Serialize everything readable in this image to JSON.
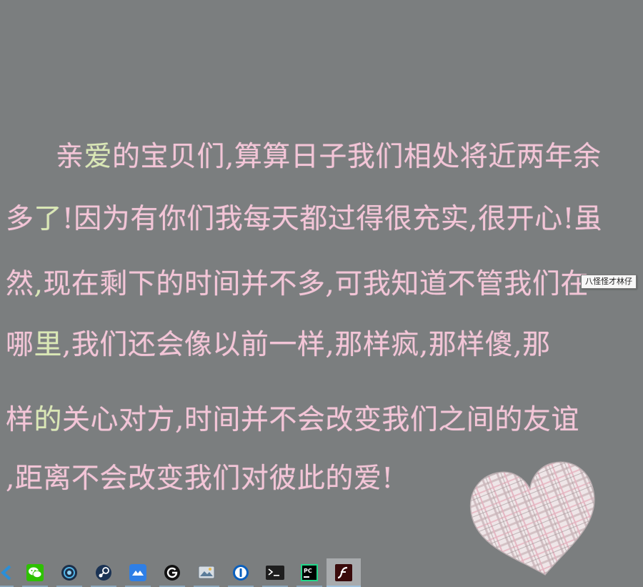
{
  "poem": {
    "line1": {
      "a": "亲",
      "b": "爱",
      "c": "的宝贝们,算算日子我们相处将近两年余"
    },
    "line2": {
      "a": "多",
      "b": "了",
      "c": "!因为有你们我每天都过得很充实,很开心!虽"
    },
    "line3": {
      "a": "然",
      "b": ",",
      "c": "现在剩下的时间并不多,可我知道不管我们在"
    },
    "line4": {
      "a": "哪",
      "b": "里",
      "c": ",我们还会像以前一样,那样疯,那样傻,那"
    },
    "line5": {
      "a": "样",
      "b": "的",
      "c": "关心对方,时间并不会改变我们之间的友谊"
    },
    "line6": {
      "a": "",
      "b": "",
      "c": ",距离不会改变我们对彼此的爱!"
    }
  },
  "tooltip": {
    "text": "八怪怪才林仔"
  },
  "colors": {
    "background": "#7b7e7f",
    "text_pink": "#f3c5d7",
    "text_accent": "#d9e8b5",
    "taskbar_indicator": "#8fb4cf"
  },
  "taskbar": {
    "apps": [
      {
        "icon": "vscode-icon",
        "active": false
      },
      {
        "icon": "wechat-icon",
        "active": false
      },
      {
        "icon": "shield-app-icon",
        "active": false
      },
      {
        "icon": "steam-icon",
        "active": false
      },
      {
        "icon": "cloud-app-icon",
        "active": false
      },
      {
        "icon": "logitech-g-icon",
        "active": false
      },
      {
        "icon": "image-viewer-icon",
        "active": false
      },
      {
        "icon": "password-manager-icon",
        "active": false
      },
      {
        "icon": "terminal-icon",
        "active": false
      },
      {
        "icon": "pycharm-icon",
        "active": false
      },
      {
        "icon": "flash-icon",
        "active": true
      }
    ]
  }
}
